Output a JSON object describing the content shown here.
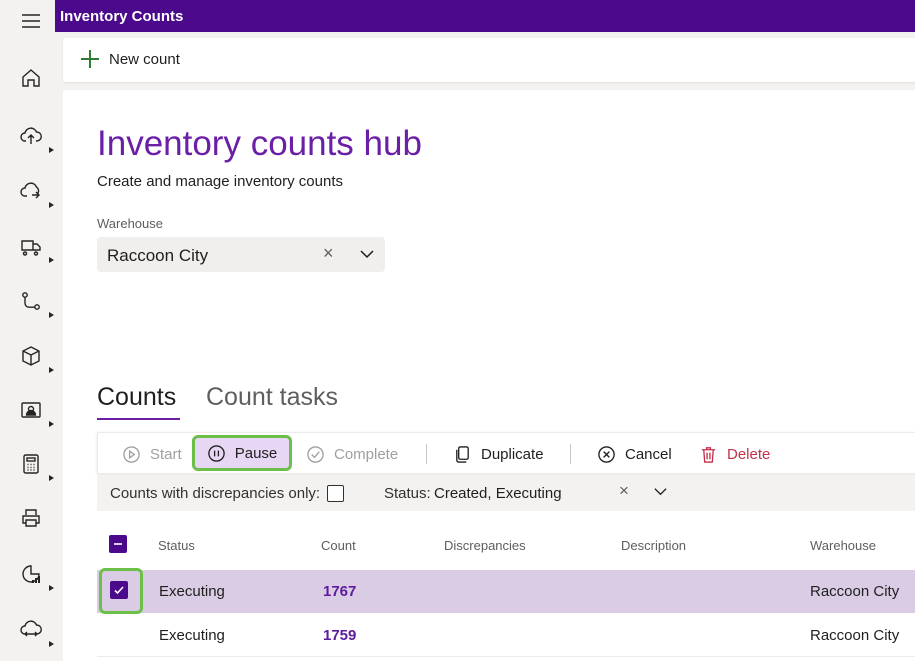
{
  "app": {
    "title": "Inventory Counts"
  },
  "nav": {
    "items": [
      {
        "icon": "home-icon"
      },
      {
        "icon": "upload-cloud-icon"
      },
      {
        "icon": "cloud-sync-icon"
      },
      {
        "icon": "truck-icon"
      },
      {
        "icon": "flow-icon"
      },
      {
        "icon": "box-icon"
      },
      {
        "icon": "contact-card-icon"
      },
      {
        "icon": "calculator-icon"
      },
      {
        "icon": "printer-icon"
      },
      {
        "icon": "analytics-icon"
      },
      {
        "icon": "cloud-transfer-icon"
      }
    ]
  },
  "commandbar": {
    "new_count_label": "New count"
  },
  "page": {
    "title": "Inventory counts hub",
    "subtitle": "Create and manage inventory counts"
  },
  "warehouse": {
    "label": "Warehouse",
    "value": "Raccoon City",
    "clear_glyph": "×"
  },
  "tabs": [
    {
      "label": "Counts",
      "selected": true
    },
    {
      "label": "Count tasks",
      "selected": false
    }
  ],
  "toolbar": {
    "start": "Start",
    "pause": "Pause",
    "complete": "Complete",
    "duplicate": "Duplicate",
    "cancel": "Cancel",
    "delete": "Delete"
  },
  "filters": {
    "discrepancies_label": "Counts with discrepancies only:",
    "status_label": "Status:",
    "status_value": "Created, Executing",
    "clear_glyph": "×"
  },
  "grid": {
    "columns": [
      "Status",
      "Count",
      "Discrepancies",
      "Description",
      "Warehouse"
    ],
    "rows": [
      {
        "status": "Executing",
        "count": "1767",
        "discrepancies": "",
        "description": "",
        "warehouse": "Raccoon City",
        "selected": true
      },
      {
        "status": "Executing",
        "count": "1759",
        "discrepancies": "",
        "description": "",
        "warehouse": "Raccoon City",
        "selected": false
      }
    ]
  },
  "colors": {
    "header_bg": "#4b0a8c",
    "accent": "#6b1fa6",
    "highlight_outline": "#6cc04a",
    "selected_row": "#dacce4",
    "danger": "#c4314b"
  }
}
